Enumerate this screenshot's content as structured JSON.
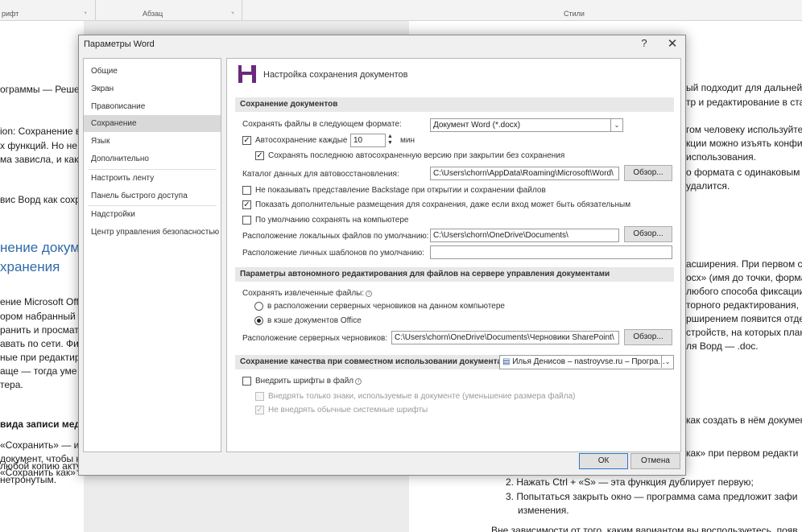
{
  "ribbon": {
    "group1": "рифт",
    "group2": "Абзац",
    "group3": "Стили"
  },
  "doc_left": [
    "ограммы — Реше",
    "ion: Сохранение в",
    "х функций. Но не",
    "ма зависла, и как",
    "вис Ворд как сохр",
    "нение докуме",
    "хранения",
    "ение Microsoft Offi",
    "ором набранный т",
    "ранить и просмат",
    "авать по сети. Фи",
    "ные при редактиро",
    "аще — тогда уме",
    "тера.",
    "вида записи мед",
    "«Сохранить» — ис",
    "документ, чтобы н",
    "«Сохранить как» —",
    "любой копию актуальной версии оригинала. Исходник, в свою очередь, останется",
    "нетронутым."
  ],
  "doc_right": [
    "ый подходит для дальней",
    "тр и редактирование в ста",
    "гом человеку используйте",
    "кции можно изъять конфи",
    "использования.",
    "о формата с одинаковым н",
    "удалится.",
    "асширения. При первом со",
    "осх» (имя до точки, форма",
    "любого способа фиксации",
    "торного редактирования,",
    "рширением появится отдел",
    "стройств, на которых план",
    "ля Ворд — .doc.",
    "как создать в нём докумен",
    "как» при первом редакти",
    "2.   Нажать Ctrl + «S» — эта функция дублирует первую;",
    "3.   Попытаться закрыть окно — программа сама предложит зафи",
    "изменения.",
    "Вне зависимости от того, каким вариантом вы воспользуетесь, появ"
  ],
  "dialog": {
    "title": "Параметры Word",
    "help": "?",
    "close": "✕",
    "nav": [
      "Общие",
      "Экран",
      "Правописание",
      "Сохранение",
      "Язык",
      "Дополнительно",
      "Настроить ленту",
      "Панель быстрого доступа",
      "Надстройки",
      "Центр управления безопасностью"
    ],
    "selected_nav": "Сохранение",
    "page_title": "Настройка сохранения документов",
    "sec1": {
      "title": "Сохранение документов",
      "format_label": "Сохранять файлы в следующем формате:",
      "format_value": "Документ Word (*.docx)",
      "autosave_label": "Автосохранение каждые",
      "autosave_value": "10",
      "autosave_unit": "мин",
      "keep_last_label": "Сохранять последнюю автосохраненную версию при закрытии без сохранения",
      "autorecover_label": "Каталог данных для автовосстановления:",
      "autorecover_path": "C:\\Users\\chorn\\AppData\\Roaming\\Microsoft\\Word\\",
      "browse": "Обзор...",
      "no_backstage_label": "Не показывать представление Backstage при открытии и сохранении файлов",
      "show_extra_label": "Показать дополнительные размещения для сохранения, даже если вход может быть обязательным",
      "save_local_label": "По умолчанию сохранять на компьютере",
      "local_label": "Расположение локальных файлов по умолчанию:",
      "local_path": "C:\\Users\\chorn\\OneDrive\\Documents\\",
      "templates_label": "Расположение личных шаблонов по умолчанию:",
      "templates_path": ""
    },
    "sec2": {
      "title": "Параметры автономного редактирования для файлов на сервере управления документами",
      "save_checked_label": "Сохранять извлеченные файлы:",
      "radio1_label": "в расположении серверных черновиков на данном компьютере",
      "radio2_label": "в кэше документов Office",
      "drafts_label": "Расположение серверных черновиков:",
      "drafts_path": "C:\\Users\\chorn\\OneDrive\\Documents\\Черновики SharePoint\\",
      "browse": "Обзор..."
    },
    "sec3": {
      "title": "Сохранение качества при совместном использовании документа:",
      "doc_value": "Илья Денисов – nastroyvse.ru – Програ...",
      "embed_label": "Внедрить шрифты в файл",
      "embed_only_label": "Внедрять только знаки, используемые в документе (уменьшение размера файла)",
      "no_common_label": "Не внедрять обычные системные шрифты"
    },
    "ok": "ОК",
    "cancel": "Отмена"
  }
}
